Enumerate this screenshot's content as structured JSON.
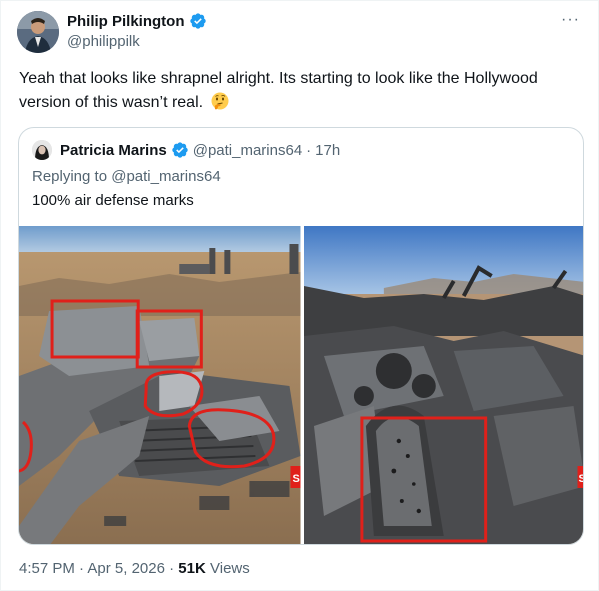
{
  "tweet": {
    "author_name": "Philip Pilkington",
    "author_handle": "@philippilk",
    "text": "Yeah that looks like shrapnel alright. Its starting to look like the Hollywood version of this wasn’t real.",
    "emoji": "thinking-face",
    "more_label": "···"
  },
  "quote": {
    "author_name": "Patricia Marins",
    "author_handle": "@pati_marins64",
    "separator": "·",
    "age": "17h",
    "replying_prefix": "Replying to",
    "replying_to": "@pati_marins64",
    "text": "100% air defense marks"
  },
  "footer": {
    "time": "4:57 PM",
    "sep1": "·",
    "date": "Apr 5, 2026",
    "sep2": "·",
    "views_count": "51K",
    "views_label": "Views"
  },
  "colors": {
    "verified": "#1d9bf0",
    "secondary_text": "#536471",
    "annotation_red": "#e0201a"
  }
}
